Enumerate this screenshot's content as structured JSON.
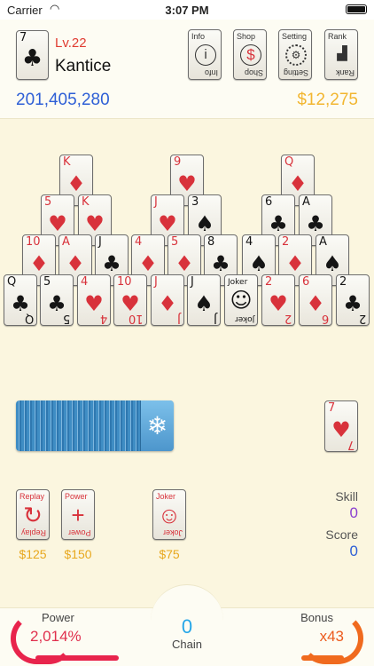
{
  "status_bar": {
    "carrier": "Carrier",
    "time": "3:07 PM"
  },
  "player": {
    "avatar_rank": "7",
    "avatar_suit": "♣",
    "level": "Lv.22",
    "name": "Kantice",
    "score": "201,405,280",
    "money": "$12,275"
  },
  "menu": {
    "info": {
      "label": "Info",
      "glyph": "i"
    },
    "shop": {
      "label": "Shop",
      "glyph": "$"
    },
    "setting": {
      "label": "Setting",
      "glyph": "⚙"
    },
    "rank": {
      "label": "Rank",
      "glyph": "▟"
    }
  },
  "pyramid": {
    "row1": [
      {
        "rank": "K",
        "suit": "♦",
        "color": "red"
      },
      {
        "rank": "9",
        "suit": "♥",
        "color": "red"
      },
      {
        "rank": "Q",
        "suit": "♦",
        "color": "red"
      }
    ],
    "row2": [
      {
        "rank": "5",
        "suit": "♥",
        "color": "red"
      },
      {
        "rank": "K",
        "suit": "♥",
        "color": "red"
      },
      {
        "rank": "J",
        "suit": "♥",
        "color": "red"
      },
      {
        "rank": "3",
        "suit": "♠",
        "color": "black"
      },
      {
        "rank": "6",
        "suit": "♣",
        "color": "black"
      },
      {
        "rank": "A",
        "suit": "♣",
        "color": "black"
      }
    ],
    "row3": [
      {
        "rank": "10",
        "suit": "♦",
        "color": "red"
      },
      {
        "rank": "A",
        "suit": "♦",
        "color": "red"
      },
      {
        "rank": "J",
        "suit": "♣",
        "color": "black"
      },
      {
        "rank": "4",
        "suit": "♦",
        "color": "red"
      },
      {
        "rank": "5",
        "suit": "♦",
        "color": "red"
      },
      {
        "rank": "8",
        "suit": "♣",
        "color": "black"
      },
      {
        "rank": "4",
        "suit": "♠",
        "color": "black"
      },
      {
        "rank": "2",
        "suit": "♦",
        "color": "red"
      },
      {
        "rank": "A",
        "suit": "♠",
        "color": "black"
      }
    ],
    "row4": [
      {
        "rank": "Q",
        "suit": "♣",
        "color": "black"
      },
      {
        "rank": "5",
        "suit": "♣",
        "color": "black"
      },
      {
        "rank": "4",
        "suit": "♥",
        "color": "red"
      },
      {
        "rank": "10",
        "suit": "♥",
        "color": "red"
      },
      {
        "rank": "J",
        "suit": "♦",
        "color": "red"
      },
      {
        "rank": "J",
        "suit": "♠",
        "color": "black"
      },
      {
        "rank": "Joker",
        "suit": "☺",
        "color": "black"
      },
      {
        "rank": "2",
        "suit": "♥",
        "color": "red"
      },
      {
        "rank": "6",
        "suit": "♦",
        "color": "red"
      },
      {
        "rank": "2",
        "suit": "♣",
        "color": "black"
      }
    ]
  },
  "deck": {
    "icon": "snowflake-icon",
    "glyph": "❄"
  },
  "waste": {
    "rank": "7",
    "suit": "♥",
    "color": "red"
  },
  "powerups": {
    "replay": {
      "label": "Replay",
      "glyph": "↻",
      "price": "$125"
    },
    "power": {
      "label": "Power",
      "glyph": "+",
      "price": "$150"
    },
    "joker": {
      "label": "Joker",
      "glyph": "☺",
      "price": "$75"
    }
  },
  "stats": {
    "skill_label": "Skill",
    "skill_value": "0",
    "score_label": "Score",
    "score_value": "0"
  },
  "footer": {
    "power_label": "Power",
    "power_value": "2,014%",
    "chain_value": "0",
    "chain_label": "Chain",
    "bonus_label": "Bonus",
    "bonus_value": "x43"
  },
  "colors": {
    "red_suit": "#d8323b",
    "score_blue": "#2e5fd6",
    "money_gold": "#f2b630",
    "deck_blue": "#3f8dc4",
    "power_red": "#e0304e",
    "bonus_orange": "#ec5b1e",
    "chain_blue": "#25a6e8"
  }
}
